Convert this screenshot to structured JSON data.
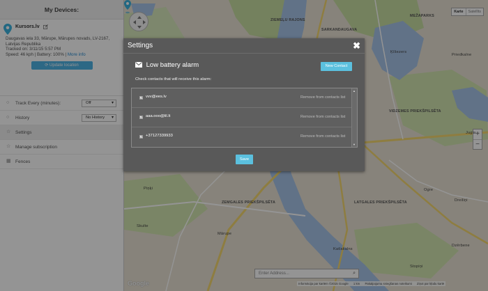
{
  "sidebar": {
    "title": "My Devices:",
    "device": {
      "name": "Kursors.lv",
      "address_line1": "Daugavas iela 33, Mārupe, Mārupes novads, LV-2167,",
      "address_line2": "Latvijas Republika",
      "tracked": "Tracked on: 3/11/15 5:57 PM",
      "speed_battery": "Speed: 46 kph | Battery: 100% |",
      "more_info": "More info",
      "update_button": "Update location"
    },
    "menu": [
      {
        "label": "Track Every (minutes):",
        "icon": "circle-icon",
        "select": "Off"
      },
      {
        "label": "History",
        "icon": "circle-icon",
        "select": "No History"
      },
      {
        "label": "Settings",
        "icon": "star-icon"
      },
      {
        "label": "Manage subscription",
        "icon": "star-icon"
      },
      {
        "label": "Fences",
        "icon": "grid-icon"
      }
    ]
  },
  "map": {
    "map_type": [
      "Karte",
      "Satellīts"
    ],
    "labels": {
      "ziemelu": "ZIEMEĻU RAJONS",
      "sarkandaugava": "SARKANDAUGAVA",
      "mezaparks": "MEŽAPARKS",
      "kisezers": "Ķīšezers",
      "priedkalne": "Priedkalne",
      "vidzemes": "VIDZEMES PRIEKŠPILSĒTA",
      "jugla": "Jugla",
      "zemgales": "ZEMGALES PRIEKŠPILSĒTA",
      "latgales": "LATGALES PRIEKŠPILSĒTA",
      "marupe": "Mārupe",
      "skulte": "Skulte",
      "ogre": "Ogre",
      "dreilini": "Dreiliņi",
      "katlakalns": "Katlakalns",
      "stopini": "Stopiņi",
      "dzerbene": "Dzērbene",
      "pinki": "Piņķi"
    },
    "address_placeholder": "Enter Address...",
    "google": "Google",
    "attribution": [
      "Informācija par kartēm ©2015 Google",
      "1 km",
      "Pakalpojumu sniegšanas noteikumi",
      "Ziņot par kļūdu kartē"
    ]
  },
  "modal": {
    "title": "Settings",
    "close": "✖",
    "alarm_title": "Low battery alarm",
    "new_contact": "New Contact",
    "instruction": "Check contacts that will receive this alarm:",
    "contacts": [
      {
        "name": "vvv@ees.lv",
        "action": "Remove from contacts list",
        "checked": true
      },
      {
        "name": "aaa.ooo@lil.lt",
        "action": "Remove from contacts list",
        "checked": true
      },
      {
        "name": "+37127339933",
        "action": "Remove from contacts list",
        "checked": true
      }
    ],
    "save": "Save"
  },
  "colors": {
    "accent": "#5bc0de",
    "modal_bg": "#595959",
    "water": "#a7c4e8",
    "park": "#c9dfa3",
    "road_major": "#f5d76e"
  }
}
